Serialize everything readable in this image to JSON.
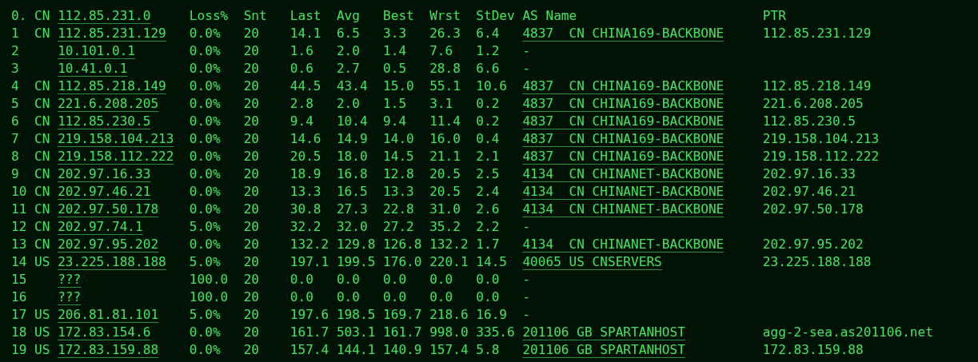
{
  "header": {
    "hop": "0.",
    "country": "CN",
    "ip": "112.85.231.0",
    "columns": [
      "Loss%",
      "Snt",
      "Last",
      "Avg",
      "Best",
      "Wrst",
      "StDev",
      "AS Name",
      "PTR"
    ]
  },
  "rows": [
    {
      "hop": "1",
      "country": "CN",
      "ip": "112.85.231.129",
      "stats": [
        "0.0%",
        "20",
        "14.1",
        "6.5",
        "3.3",
        "26.3",
        "6.4"
      ],
      "as_name": "4837  CN CHINA169-BACKBONE",
      "as_linked": true,
      "ptr": "112.85.231.129"
    },
    {
      "hop": "2",
      "ip": "10.101.0.1",
      "stats": [
        "0.0%",
        "20",
        "1.6",
        "2.0",
        "1.4",
        "7.6",
        "1.2"
      ],
      "as_name": "-",
      "as_linked": false
    },
    {
      "hop": "3",
      "ip": "10.41.0.1",
      "stats": [
        "0.0%",
        "20",
        "0.6",
        "2.7",
        "0.5",
        "28.8",
        "6.6"
      ],
      "as_name": "-",
      "as_linked": false
    },
    {
      "hop": "4",
      "country": "CN",
      "ip": "112.85.218.149",
      "stats": [
        "0.0%",
        "20",
        "44.5",
        "43.4",
        "15.0",
        "55.1",
        "10.6"
      ],
      "as_name": "4837  CN CHINA169-BACKBONE",
      "as_linked": true,
      "ptr": "112.85.218.149"
    },
    {
      "hop": "5",
      "country": "CN",
      "ip": "221.6.208.205",
      "stats": [
        "0.0%",
        "20",
        "2.8",
        "2.0",
        "1.5",
        "3.1",
        "0.2"
      ],
      "as_name": "4837  CN CHINA169-BACKBONE",
      "as_linked": true,
      "ptr": "221.6.208.205"
    },
    {
      "hop": "6",
      "country": "CN",
      "ip": "112.85.230.5",
      "stats": [
        "0.0%",
        "20",
        "9.4",
        "10.4",
        "9.4",
        "11.4",
        "0.2"
      ],
      "as_name": "4837  CN CHINA169-BACKBONE",
      "as_linked": true,
      "ptr": "112.85.230.5"
    },
    {
      "hop": "7",
      "country": "CN",
      "ip": "219.158.104.213",
      "stats": [
        "0.0%",
        "20",
        "14.6",
        "14.9",
        "14.0",
        "16.0",
        "0.4"
      ],
      "as_name": "4837  CN CHINA169-BACKBONE",
      "as_linked": true,
      "ptr": "219.158.104.213"
    },
    {
      "hop": "8",
      "country": "CN",
      "ip": "219.158.112.222",
      "stats": [
        "0.0%",
        "20",
        "20.5",
        "18.0",
        "14.5",
        "21.1",
        "2.1"
      ],
      "as_name": "4837  CN CHINA169-BACKBONE",
      "as_linked": true,
      "ptr": "219.158.112.222"
    },
    {
      "hop": "9",
      "country": "CN",
      "ip": "202.97.16.33",
      "stats": [
        "0.0%",
        "20",
        "18.9",
        "16.8",
        "12.8",
        "20.5",
        "2.5"
      ],
      "as_name": "4134  CN CHINANET-BACKBONE",
      "as_linked": true,
      "ptr": "202.97.16.33"
    },
    {
      "hop": "10",
      "country": "CN",
      "ip": "202.97.46.21",
      "stats": [
        "0.0%",
        "20",
        "13.3",
        "16.5",
        "13.3",
        "20.5",
        "2.4"
      ],
      "as_name": "4134  CN CHINANET-BACKBONE",
      "as_linked": true,
      "ptr": "202.97.46.21"
    },
    {
      "hop": "11",
      "country": "CN",
      "ip": "202.97.50.178",
      "stats": [
        "0.0%",
        "20",
        "30.8",
        "27.3",
        "22.8",
        "31.0",
        "2.6"
      ],
      "as_name": "4134  CN CHINANET-BACKBONE",
      "as_linked": true,
      "ptr": "202.97.50.178"
    },
    {
      "hop": "12",
      "country": "CN",
      "ip": "202.97.74.1",
      "stats": [
        "5.0%",
        "20",
        "32.2",
        "32.0",
        "27.2",
        "35.2",
        "2.2"
      ],
      "as_name": "-",
      "as_linked": false
    },
    {
      "hop": "13",
      "country": "CN",
      "ip": "202.97.95.202",
      "stats": [
        "0.0%",
        "20",
        "132.2",
        "129.8",
        "126.8",
        "132.2",
        "1.7"
      ],
      "as_name": "4134  CN CHINANET-BACKBONE",
      "as_linked": true,
      "ptr": "202.97.95.202"
    },
    {
      "hop": "14",
      "country": "US",
      "ip": "23.225.188.188",
      "stats": [
        "5.0%",
        "20",
        "197.1",
        "199.5",
        "176.0",
        "220.1",
        "14.5"
      ],
      "as_name": "40065 US CNSERVERS",
      "as_linked": true,
      "ptr": "23.225.188.188"
    },
    {
      "hop": "15",
      "ip": "???",
      "stats": [
        "100.0",
        "20",
        "0.0",
        "0.0",
        "0.0",
        "0.0",
        "0.0"
      ],
      "as_name": "-",
      "as_linked": false
    },
    {
      "hop": "16",
      "ip": "???",
      "stats": [
        "100.0",
        "20",
        "0.0",
        "0.0",
        "0.0",
        "0.0",
        "0.0"
      ],
      "as_name": "-",
      "as_linked": false
    },
    {
      "hop": "17",
      "country": "US",
      "ip": "206.81.81.101",
      "stats": [
        "5.0%",
        "20",
        "197.6",
        "198.5",
        "169.7",
        "218.6",
        "16.9"
      ],
      "as_name": "-",
      "as_linked": false
    },
    {
      "hop": "18",
      "country": "US",
      "ip": "172.83.154.6",
      "stats": [
        "0.0%",
        "20",
        "161.7",
        "503.1",
        "161.7",
        "998.0",
        "335.6"
      ],
      "as_name": "201106 GB SPARTANHOST",
      "as_linked": true,
      "ptr": "agg-2-sea.as201106.net"
    },
    {
      "hop": "19",
      "country": "US",
      "ip": "172.83.159.88",
      "stats": [
        "0.0%",
        "20",
        "157.4",
        "144.1",
        "140.9",
        "157.4",
        "5.8"
      ],
      "as_name": "201106 GB SPARTANHOST",
      "as_linked": true,
      "ptr": "172.83.159.88"
    }
  ]
}
